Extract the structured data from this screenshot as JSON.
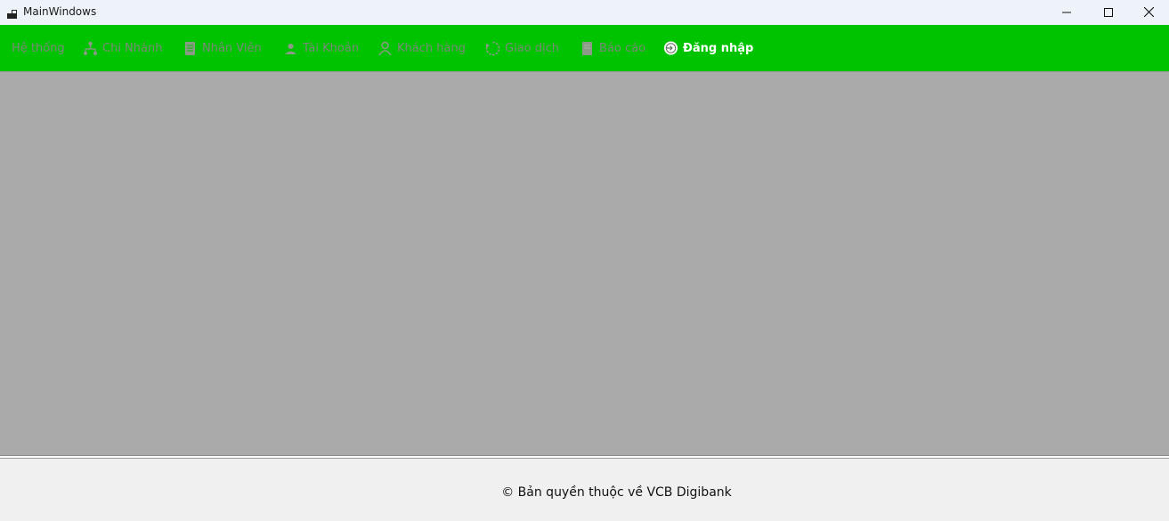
{
  "window": {
    "title": "MainWindows"
  },
  "menu": {
    "items": [
      {
        "label": "Hệ thống",
        "icon": "none",
        "enabled": false
      },
      {
        "label": "Chi Nhánh",
        "icon": "branch-icon",
        "enabled": false
      },
      {
        "label": "Nhân Viên",
        "icon": "employee-icon",
        "enabled": false
      },
      {
        "label": "Tài Khoản",
        "icon": "account-icon",
        "enabled": false
      },
      {
        "label": "Khách hàng",
        "icon": "customer-icon",
        "enabled": false
      },
      {
        "label": "Giao dịch",
        "icon": "transaction-icon",
        "enabled": false
      },
      {
        "label": "Báo cáo",
        "icon": "report-icon",
        "enabled": false
      },
      {
        "label": "Đăng nhập",
        "icon": "login-icon",
        "enabled": true
      }
    ],
    "background_color": "#00c300"
  },
  "footer": {
    "copyright": "© Bản quyền thuộc về VCB Digibank"
  },
  "colors": {
    "content_background": "#aaaaaa",
    "disabled_text": "#7a8a78",
    "active_text": "#ffffff"
  }
}
